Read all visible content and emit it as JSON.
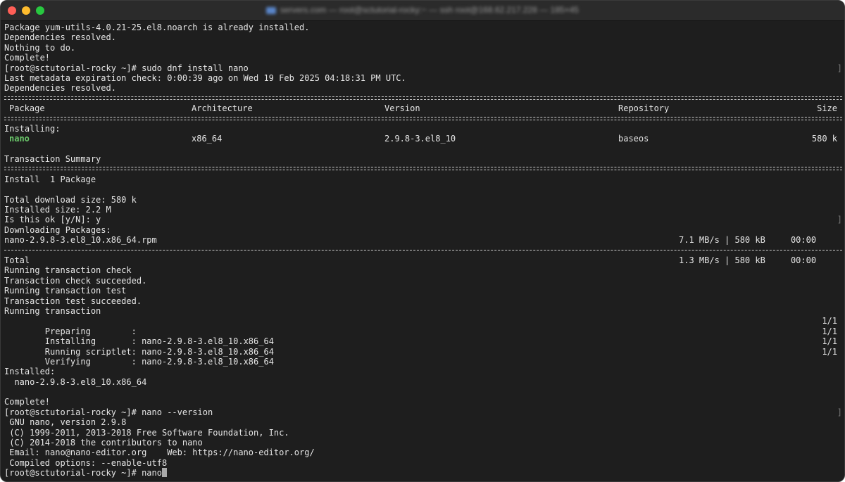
{
  "window": {
    "title": "servers.com — root@sctutorial-rocky:~ — ssh root@168.62.217.228 — 185×45"
  },
  "lines": {
    "l01": "Package yum-utils-4.0.21-25.el8.noarch is already installed.",
    "l02": "Dependencies resolved.",
    "l03": "Nothing to do.",
    "l04": "Complete!",
    "l05": "[root@sctutorial-rocky ~]# sudo dnf install nano",
    "l06": "Last metadata expiration check: 0:00:39 ago on Wed 19 Feb 2025 04:18:31 PM UTC.",
    "l07": "Dependencies resolved.",
    "installing_header": "Installing:",
    "transaction_summary": "Transaction Summary",
    "install_count": "Install  1 Package",
    "total_download": "Total download size: 580 k",
    "installed_size": "Installed size: 2.2 M",
    "prompt_ok": "Is this ok [y/N]: y",
    "downloading": "Downloading Packages:",
    "running_check": "Running transaction check",
    "check_succeeded": "Transaction check succeeded.",
    "running_test": "Running transaction test",
    "test_succeeded": "Transaction test succeeded.",
    "running_tx": "Running transaction",
    "installed_header": "Installed:",
    "installed_pkg": "  nano-2.9.8-3.el8_10.x86_64",
    "complete2": "Complete!",
    "cmd_version": "[root@sctutorial-rocky ~]# nano --version",
    "v1": " GNU nano, version 2.9.8",
    "v2": " (C) 1999-2011, 2013-2018 Free Software Foundation, Inc.",
    "v3": " (C) 2014-2018 the contributors to nano",
    "v4": " Email: nano@nano-editor.org    Web: https://nano-editor.org/",
    "v5": " Compiled options: --enable-utf8",
    "final_prompt": "[root@sctutorial-rocky ~]# nano"
  },
  "table": {
    "headers": {
      "package": "Package",
      "arch": "Architecture",
      "version": "Version",
      "repo": "Repository",
      "size": "Size"
    },
    "row": {
      "package": "nano",
      "arch": "x86_64",
      "version": "2.9.8-3.el8_10",
      "repo": "baseos",
      "size": "580 k"
    }
  },
  "download": {
    "file": "nano-2.9.8-3.el8_10.x86_64.rpm",
    "file_stats": "7.1 MB/s | 580 kB     00:00",
    "total_label": "Total",
    "total_stats": "1.3 MB/s | 580 kB     00:00"
  },
  "steps": [
    {
      "label": "  Preparing        :",
      "detail": "",
      "progress": "1/1"
    },
    {
      "label": "  Installing       :",
      "detail": " nano-2.9.8-3.el8_10.x86_64",
      "progress": "1/1"
    },
    {
      "label": "  Running scriptlet:",
      "detail": " nano-2.9.8-3.el8_10.x86_64",
      "progress": "1/1"
    },
    {
      "label": "  Verifying        :",
      "detail": " nano-2.9.8-3.el8_10.x86_64",
      "progress": "1/1"
    }
  ],
  "colors": {
    "background": "#1e1e1e",
    "text": "#e6e6e6",
    "package_highlight": "#6ac76a"
  }
}
